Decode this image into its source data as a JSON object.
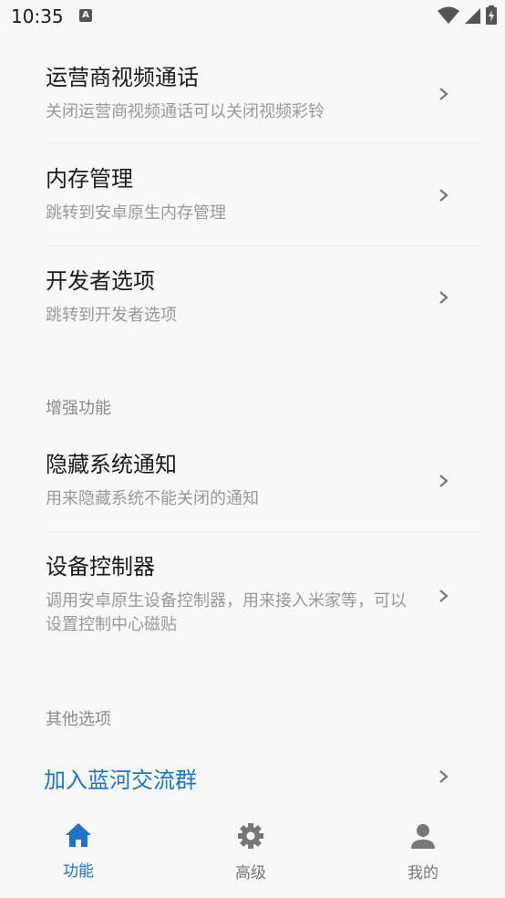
{
  "status_bar": {
    "time": "10:35",
    "notification_glyph": "A"
  },
  "settings_top": [
    {
      "title": "运营商视频通话",
      "subtitle": "关闭运营商视频通话可以关闭视频彩铃"
    },
    {
      "title": "内存管理",
      "subtitle": "跳转到安卓原生内存管理"
    },
    {
      "title": "开发者选项",
      "subtitle": "跳转到开发者选项"
    }
  ],
  "sections": {
    "enhance": {
      "header": "增强功能",
      "items": [
        {
          "title": "隐藏系统通知",
          "subtitle": "用来隐藏系统不能关闭的通知"
        },
        {
          "title": "设备控制器",
          "subtitle": "调用安卓原生设备控制器，用来接入米家等，可以设置控制中心磁贴"
        }
      ]
    },
    "other": {
      "header": "其他选项",
      "link": "加入蓝河交流群"
    }
  },
  "bottom_nav": [
    {
      "label": "功能",
      "icon": "home-icon",
      "active": true
    },
    {
      "label": "高级",
      "icon": "gear-icon",
      "active": false
    },
    {
      "label": "我的",
      "icon": "person-icon",
      "active": false
    }
  ],
  "colors": {
    "accent": "#1e73c8",
    "background": "#f8f8f8"
  }
}
